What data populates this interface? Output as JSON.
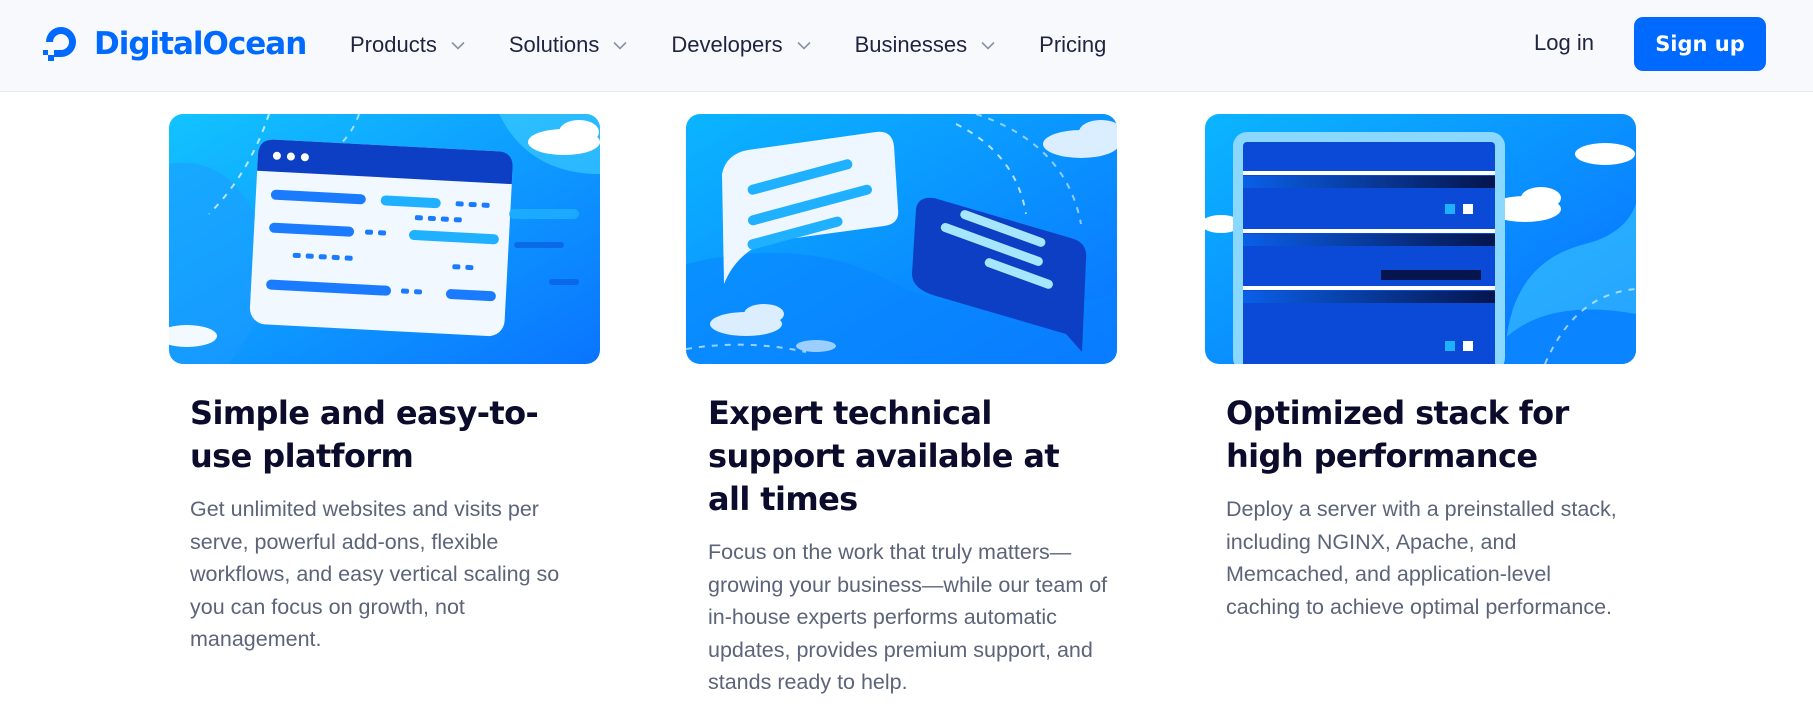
{
  "brand": {
    "name": "DigitalOcean",
    "color": "#0069ff",
    "logo_icon": "digitalocean-logo-icon"
  },
  "nav": {
    "items": [
      {
        "label": "Products",
        "has_dropdown": true
      },
      {
        "label": "Solutions",
        "has_dropdown": true
      },
      {
        "label": "Developers",
        "has_dropdown": true
      },
      {
        "label": "Businesses",
        "has_dropdown": true
      },
      {
        "label": "Pricing",
        "has_dropdown": false
      }
    ],
    "login_label": "Log in",
    "signup_label": "Sign up"
  },
  "features": [
    {
      "title": "Simple and easy-to-use platform",
      "body": "Get unlimited websites and visits per serve, powerful add-ons, flexible workflows, and easy vertical scaling so you can focus on growth, not management.",
      "illustration": "browser-window-illustration"
    },
    {
      "title": "Expert technical support available at all times",
      "body": "Focus on the work that truly matters—growing your business—while our team of in-house experts performs automatic updates, provides premium support, and stands ready to help.",
      "illustration": "chat-bubbles-illustration"
    },
    {
      "title": "Optimized stack for high performance",
      "body": "Deploy a server with a preinstalled stack, including NGINX, Apache, and Memcached, and application-level caching to achieve optimal performance.",
      "illustration": "server-rack-illustration"
    }
  ],
  "colors": {
    "nav_background": "#f7f9fc",
    "illustration_blue": "#0bb5ff",
    "heading": "#0b0b2b",
    "body_text": "#5b6478"
  }
}
